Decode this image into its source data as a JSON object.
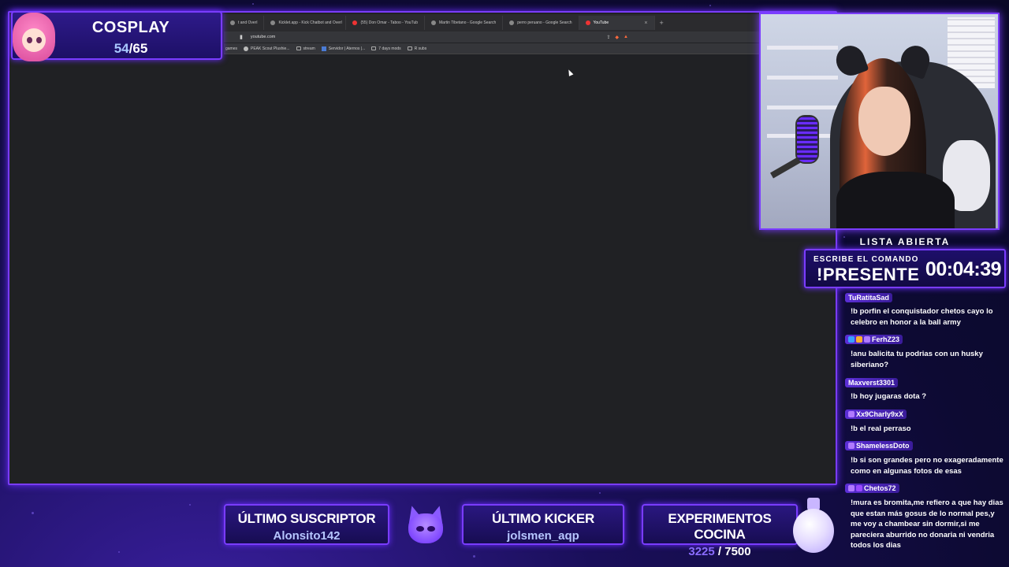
{
  "browser": {
    "tabs": [
      {
        "label": "t and Overl",
        "active": false
      },
      {
        "label": "Kicklet.app - Kick Chatbot and Overl",
        "active": false
      },
      {
        "label": "(55) Don Omar - Taboo - YouTub",
        "active": false
      },
      {
        "label": "Martin Tibetano - Google Search",
        "active": false
      },
      {
        "label": "perro peruano - Google Search",
        "active": false
      },
      {
        "label": "YouTube",
        "active": true
      }
    ],
    "address": "youtube.com",
    "bookmarks": [
      "games",
      "PEAK Scout Plushie...",
      "stream",
      "Servidor | Aternos |...",
      "7 days mods",
      "R subs"
    ]
  },
  "cosplay": {
    "title": "COSPLAY",
    "current": "54",
    "total": "/65"
  },
  "lista": {
    "title": "LISTA ABIERTA",
    "command_label": "ESCRIBE EL COMANDO",
    "command": "!PRESENTE",
    "timer": "00:04:39"
  },
  "chat": [
    {
      "user": "TuRatitaSad",
      "badges": [],
      "text": "!b porfin el conquistador chetos cayo lo celebro en honor a la ball army"
    },
    {
      "user": "FerhZ23",
      "badges": [
        "b1",
        "b2",
        "b3"
      ],
      "text": "!anu balicita tu podrias con un husky siberiano?"
    },
    {
      "user": "Maxverst3301",
      "badges": [],
      "text": "!b hoy jugaras dota ?"
    },
    {
      "user": "Xx9Charly9xX",
      "badges": [
        "b3"
      ],
      "text": "!b el real perraso"
    },
    {
      "user": "ShamelessDoto",
      "badges": [
        "b3"
      ],
      "text": "!b si son grandes pero no exageradamente como en algunas fotos de esas"
    },
    {
      "user": "Chetos72",
      "badges": [
        "b3",
        "b4"
      ],
      "text": "!mura es bromita,me refiero a que hay dias que estan más gosus de lo normal pes,y me voy a chambear sin dormir,si me pareciera aburrido no donaria ni vendria todos los dias"
    }
  ],
  "bottom": {
    "suscriptor_label": "ÚLTIMO SUSCRIPTOR",
    "suscriptor_value": "Alonsito142",
    "kicker_label": "ÚLTIMO KICKER",
    "kicker_value": "jolsmen_aqp",
    "cocina_label": "EXPERIMENTOS COCINA",
    "cocina_current": "3225",
    "cocina_total": " / 7500"
  }
}
